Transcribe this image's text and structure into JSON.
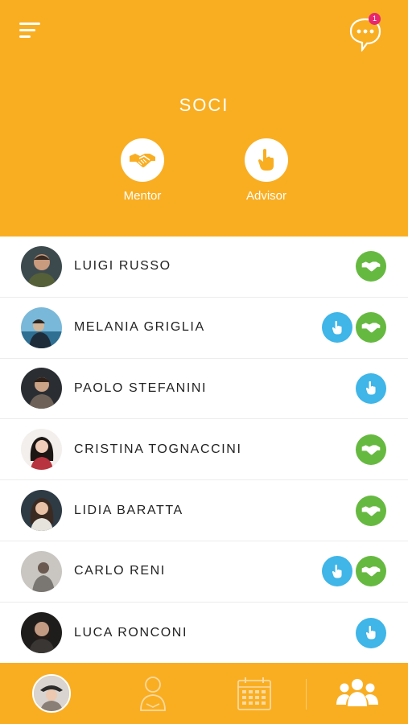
{
  "header": {
    "title": "SOCI",
    "chat_badge_count": "1",
    "roles": [
      {
        "label": "Mentor",
        "icon": "handshake-icon"
      },
      {
        "label": "Advisor",
        "icon": "pointing-hand-icon"
      }
    ]
  },
  "members": [
    {
      "name": "LUIGI RUSSO",
      "roles": [
        "mentor"
      ]
    },
    {
      "name": "MELANIA GRIGLIA",
      "roles": [
        "advisor",
        "mentor"
      ]
    },
    {
      "name": "PAOLO STEFANINI",
      "roles": [
        "advisor"
      ]
    },
    {
      "name": "CRISTINA TOGNACCINI",
      "roles": [
        "mentor"
      ]
    },
    {
      "name": "LIDIA BARATTA",
      "roles": [
        "mentor"
      ]
    },
    {
      "name": "CARLO RENI",
      "roles": [
        "advisor",
        "mentor"
      ]
    },
    {
      "name": "LUCA RONCONI",
      "roles": [
        "advisor"
      ]
    }
  ],
  "tabbar": {
    "tabs": [
      "profile-avatar",
      "person-icon",
      "calendar-icon",
      "group-icon"
    ],
    "active_tab": "group-icon"
  },
  "colors": {
    "primary": "#f9ae22",
    "mentor_badge": "#66b940",
    "advisor_badge": "#3fb5e8",
    "notification": "#e8276f"
  }
}
